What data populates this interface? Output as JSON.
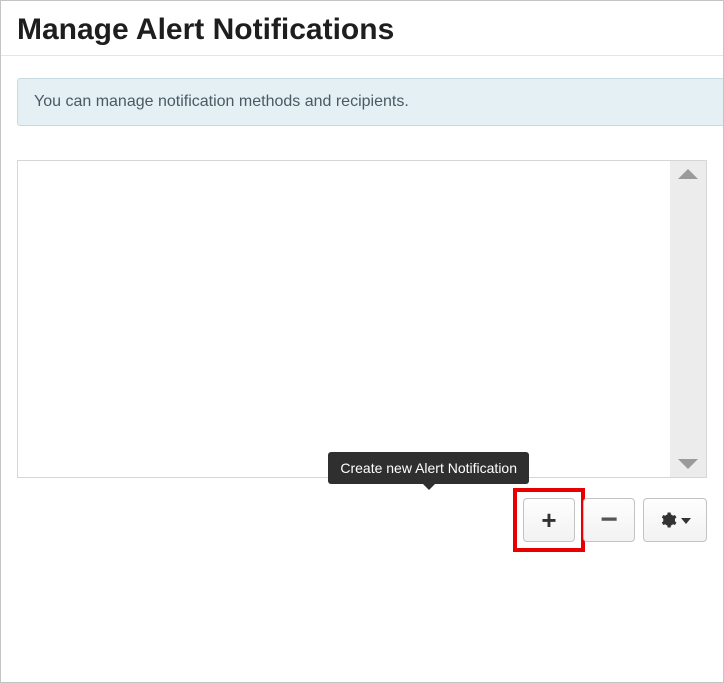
{
  "header": {
    "title": "Manage Alert Notifications"
  },
  "info": {
    "message": "You can manage notification methods and recipients."
  },
  "tooltip": {
    "add": "Create new Alert Notification"
  },
  "buttons": {
    "add": {
      "glyph": "+",
      "name": "Add"
    },
    "remove": {
      "glyph": "−",
      "name": "Remove"
    },
    "settings": {
      "name": "Settings"
    }
  }
}
